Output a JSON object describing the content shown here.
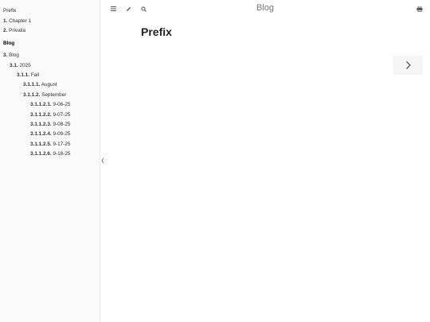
{
  "book": {
    "title": "Blog"
  },
  "sidebar": {
    "items": [
      {
        "num": "",
        "label": "Prefix"
      },
      {
        "num": "1.",
        "label": "Chapter 1"
      },
      {
        "num": "2.",
        "label": "Privalia"
      }
    ],
    "part_title": "Blog",
    "blog_items": [
      {
        "num": "3.",
        "label": "Blog"
      },
      {
        "num": "3.1.",
        "label": "2025"
      },
      {
        "num": "3.1.1.",
        "label": "Fall"
      },
      {
        "num": "3.1.1.1.",
        "label": "August"
      },
      {
        "num": "3.1.1.2.",
        "label": "September"
      },
      {
        "num": "3.1.1.2.1.",
        "label": "9-06-25"
      },
      {
        "num": "3.1.1.2.2.",
        "label": "9-07-25"
      },
      {
        "num": "3.1.1.2.3.",
        "label": "9-08-25"
      },
      {
        "num": "3.1.1.2.4.",
        "label": "9-09-25"
      },
      {
        "num": "3.1.1.2.5.",
        "label": "9-17-25"
      },
      {
        "num": "3.1.1.2.6.",
        "label": "9-18-25"
      }
    ]
  },
  "menubar": {
    "icons": [
      "menu-icon",
      "pencil-icon",
      "search-icon",
      "print-icon"
    ]
  },
  "content": {
    "heading": "Prefix"
  },
  "nav": {
    "next_icon": "chevron-right-icon"
  }
}
